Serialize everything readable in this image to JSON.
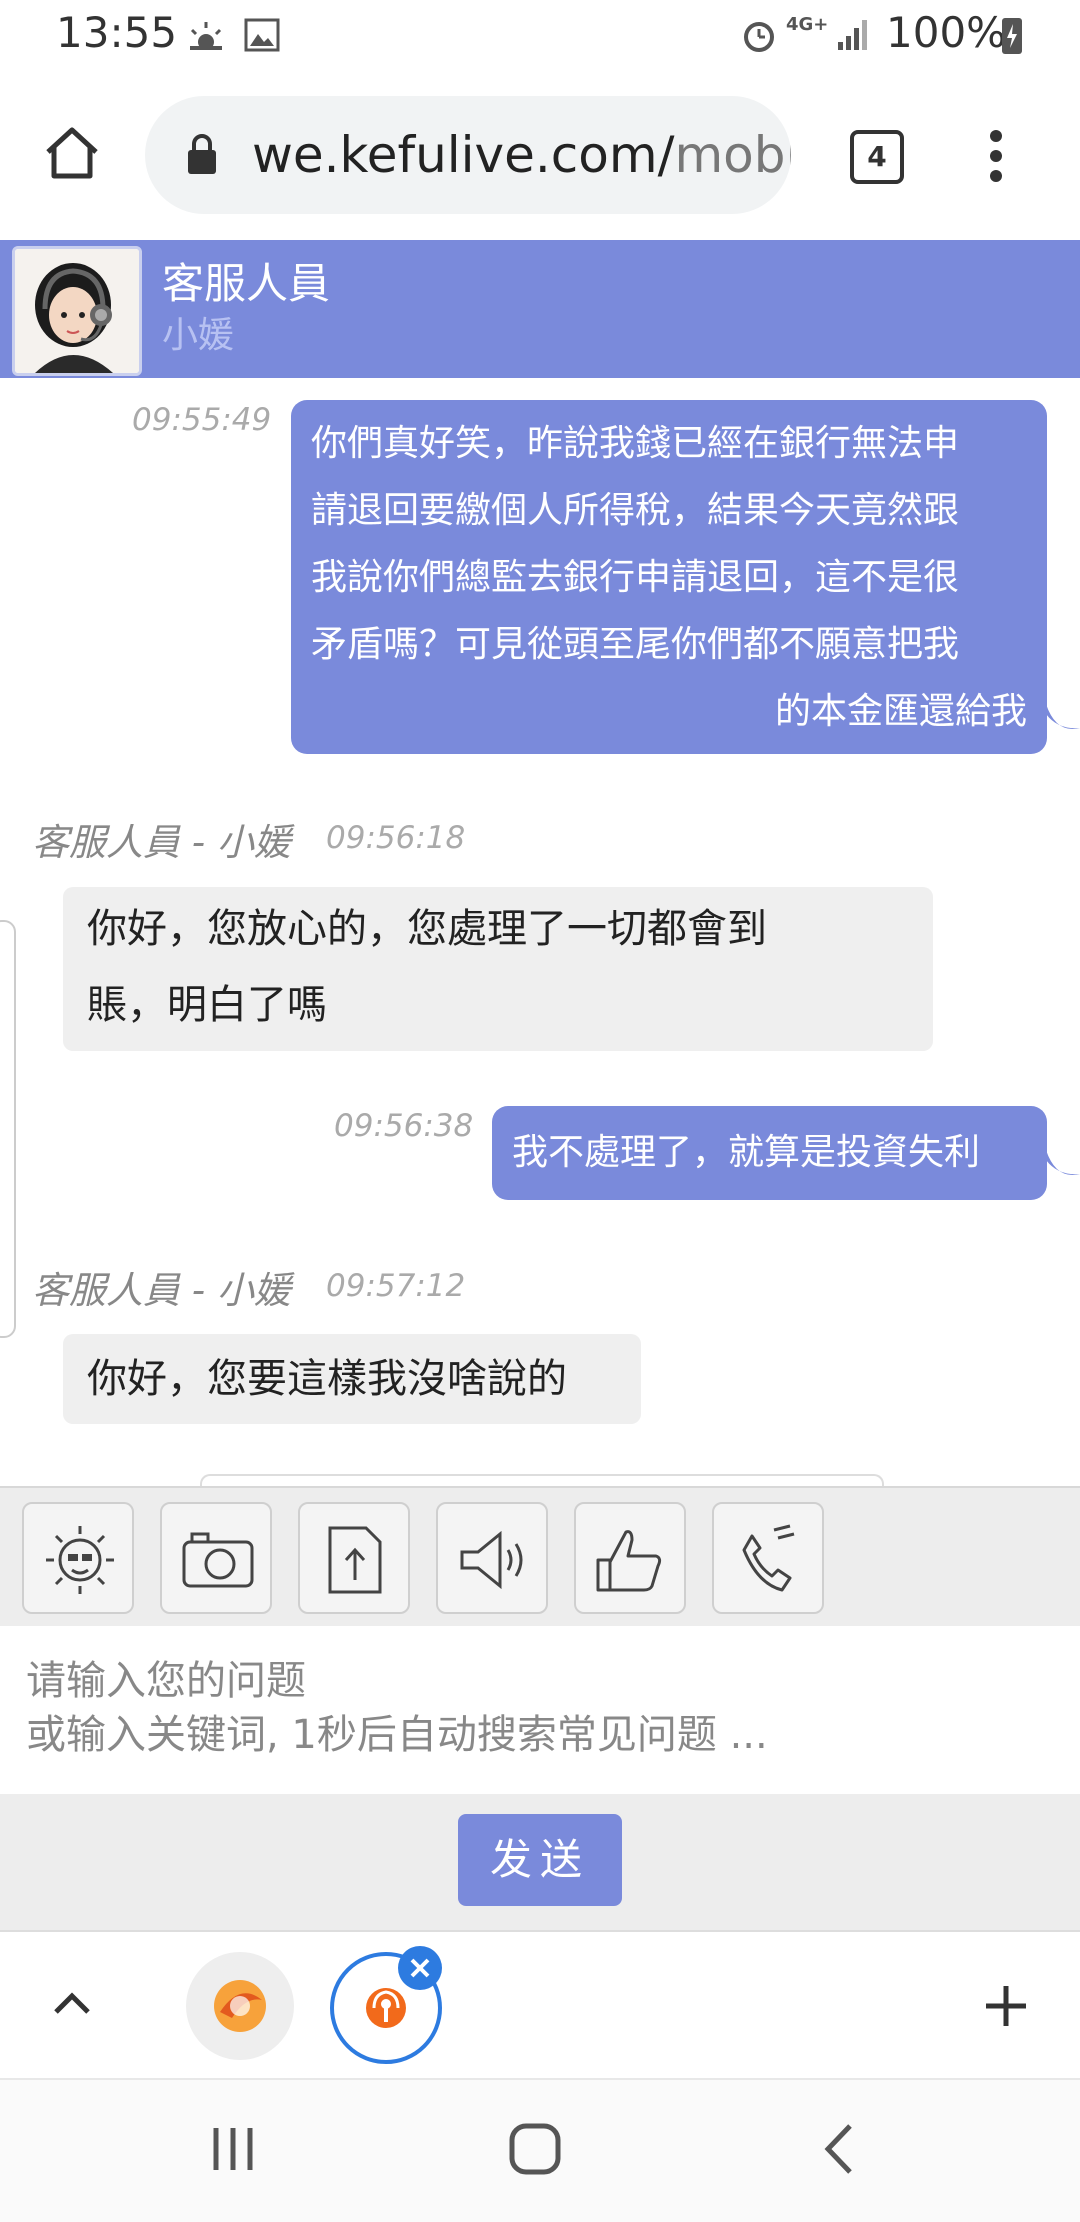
{
  "status_bar": {
    "time": "13:55",
    "battery": "100%",
    "network": "4G+"
  },
  "browser": {
    "url_main": "we.kefulive.com/",
    "url_rest": "mobi",
    "tab_count": "4"
  },
  "chat_header": {
    "title": "客服人員",
    "agent_name": "小媛"
  },
  "messages": [
    {
      "from": "user",
      "time": "09:55:49",
      "lines": [
        "你們真好笑，昨說我錢已經在銀行無法申",
        "請退回要繳個人所得稅，結果今天竟然跟",
        "我說你們總監去銀行申請退回，這不是很",
        "矛盾嗎？可見從頭至尾你們都不願意把我",
        "的本金匯還給我"
      ]
    },
    {
      "from": "agent",
      "sender": "客服人員 - 小媛",
      "time": "09:56:18",
      "lines": [
        "你好，您放心的，您處理了一切都會到",
        "賬，明白了嗎"
      ]
    },
    {
      "from": "user",
      "time": "09:56:38",
      "lines": [
        "我不處理了，就算是投資失利"
      ]
    },
    {
      "from": "agent",
      "sender": "客服人員 - 小媛",
      "time": "09:57:12",
      "lines": [
        "你好，您要這樣我沒啥說的"
      ]
    }
  ],
  "toolbar": {
    "icons": [
      "emoji-icon",
      "camera-icon",
      "upload-icon",
      "voice-icon",
      "like-icon",
      "phone-icon"
    ]
  },
  "input": {
    "placeholder_line1": "请输入您的问题",
    "placeholder_line2": "或输入关键词, 1秒后自动搜索常见问题 ..."
  },
  "send_button": {
    "label": "发送"
  },
  "colors": {
    "accent": "#7a8adb",
    "bubble_agent": "#efefef",
    "toolbar_bg": "#ededed"
  }
}
